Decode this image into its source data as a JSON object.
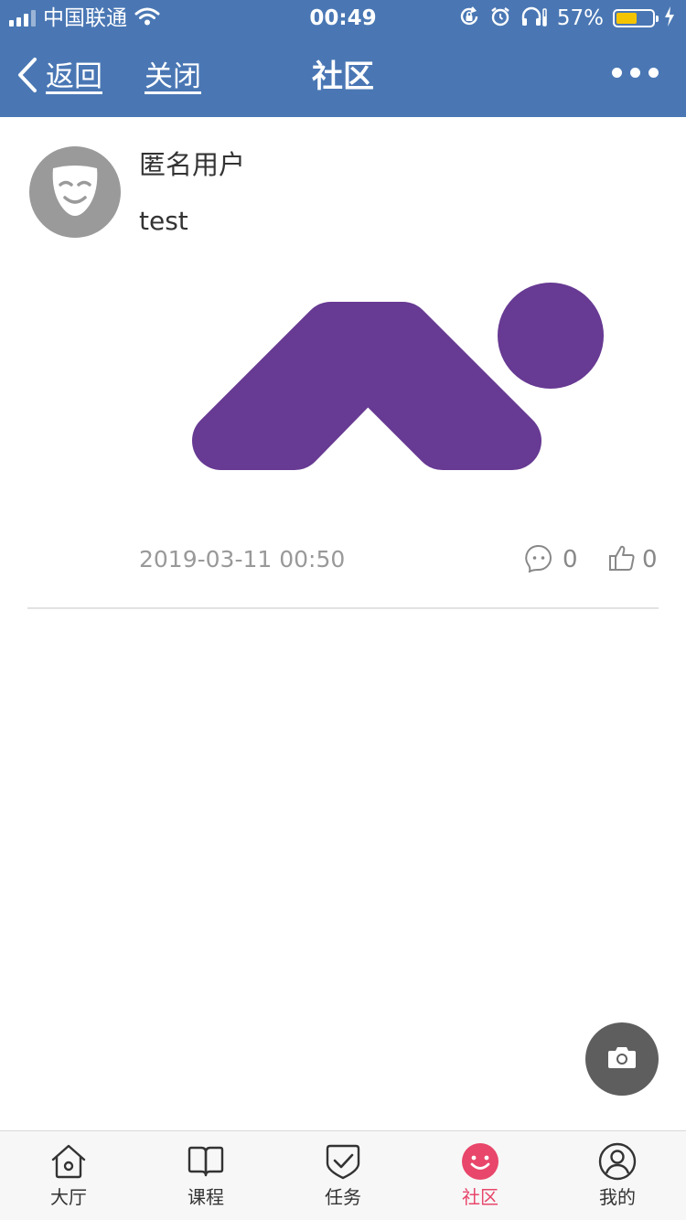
{
  "status_bar": {
    "carrier": "中国联通",
    "time": "00:49",
    "battery_percent": "57%",
    "battery_level": 0.57,
    "icons": [
      "signal-icon",
      "wifi-icon",
      "rotation-lock-icon",
      "alarm-icon",
      "headphones-icon",
      "battery-icon",
      "charging-icon"
    ]
  },
  "nav": {
    "back_label": "返回",
    "close_label": "关闭",
    "title": "社区",
    "more_icon": "more-icon",
    "bar_color": "#4a77b4"
  },
  "post": {
    "username": "匿名用户",
    "text": "test",
    "timestamp": "2019-03-11 00:50",
    "comment_count": "0",
    "like_count": "0",
    "avatar_icon": "mask-icon",
    "image_color": "#673a93"
  },
  "fab": {
    "icon": "camera-icon"
  },
  "tab_bar": {
    "active_color": "#e8466a",
    "tabs": [
      {
        "label": "大厅",
        "icon": "home-icon"
      },
      {
        "label": "课程",
        "icon": "book-icon"
      },
      {
        "label": "任务",
        "icon": "task-check-icon"
      },
      {
        "label": "社区",
        "icon": "community-smile-icon",
        "active": true
      },
      {
        "label": "我的",
        "icon": "profile-icon"
      }
    ]
  }
}
